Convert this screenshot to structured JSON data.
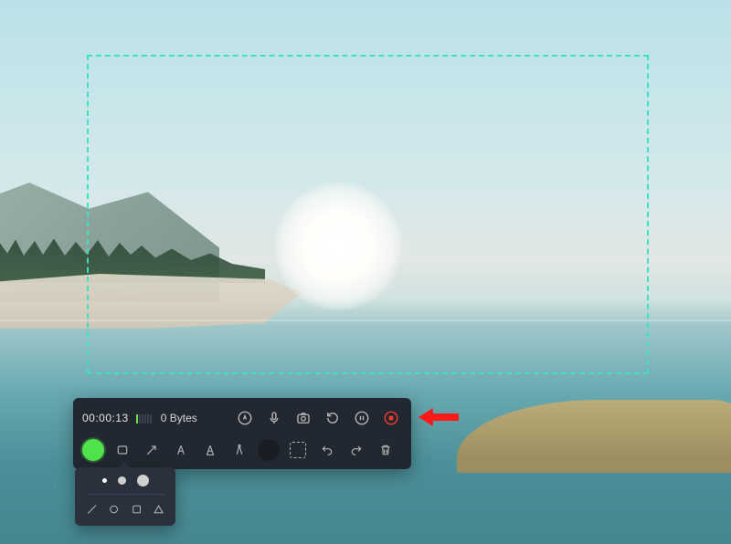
{
  "capture": {
    "timer": "00:00:13",
    "file_size": "0 Bytes"
  },
  "colors": {
    "selection_border": "#3fe0c4",
    "active_color": "#4fe24a",
    "stop": "#ff3b30",
    "arrow_annotation": "#ff1a1a"
  },
  "controls": {
    "cursor": "cursor-icon",
    "mic": "microphone-icon",
    "camera": "camera-icon",
    "restart": "restart-icon",
    "pause": "pause-icon",
    "stop": "stop-icon"
  },
  "tools": {
    "color_picker": "color-picker",
    "rectangle": "rectangle-tool",
    "arrow": "arrow-tool",
    "text": "text-tool",
    "marker": "marker-tool",
    "measure": "measure-tool",
    "brush_preview": "brush-preview",
    "selection": "selection-tool",
    "undo": "undo",
    "redo": "redo",
    "trash": "trash"
  },
  "popover": {
    "sizes": [
      "small",
      "medium",
      "large"
    ],
    "shapes": [
      "line",
      "circle",
      "square",
      "triangle"
    ]
  }
}
